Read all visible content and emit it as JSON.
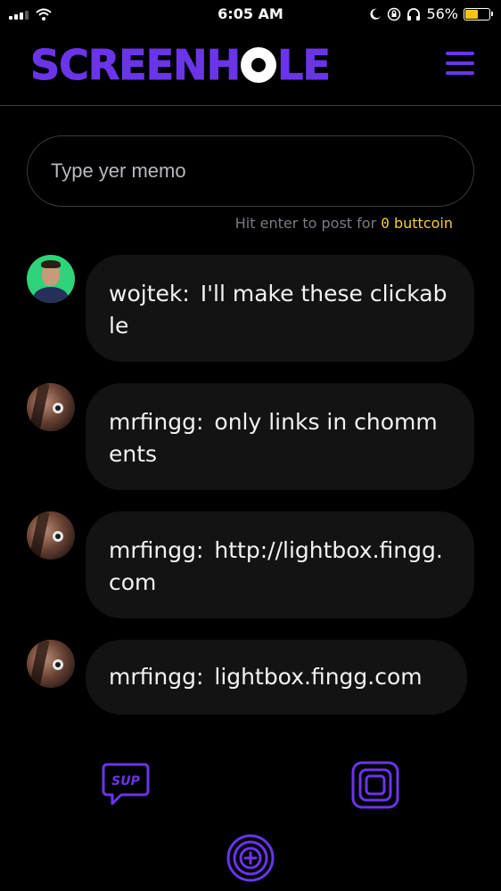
{
  "status_bar": {
    "carrier": "•▪▪▪▪▪",
    "time": "6:05 AM",
    "battery_percent": "56%",
    "battery_level": 0.56,
    "battery_color": "#f5c416"
  },
  "header": {
    "logo_text": "SCREENHOLE",
    "menu_icon": "hamburger-menu-icon",
    "accent": "#6a35e8"
  },
  "composer": {
    "placeholder": "Type yer memo",
    "hint_prefix": "Hit enter to post for",
    "cost_amount": "0",
    "cost_unit": "buttcoin"
  },
  "messages": [
    {
      "user": "wojtek",
      "text": "I'll make these clickable",
      "avatar": "green-profile-avatar"
    },
    {
      "user": "mrfingg",
      "text": "only links in chomments",
      "avatar": "eye-face-avatar"
    },
    {
      "user": "mrfingg",
      "text": "http://lightbox.fingg.com",
      "avatar": "eye-face-avatar"
    },
    {
      "user": "mrfingg",
      "text": "lightbox.fingg.com",
      "avatar": "eye-face-avatar"
    }
  ],
  "bottom_nav": {
    "sup_label": "SUP",
    "frame_icon": "screen-frame-icon",
    "add_icon": "plus-circle-icon"
  }
}
